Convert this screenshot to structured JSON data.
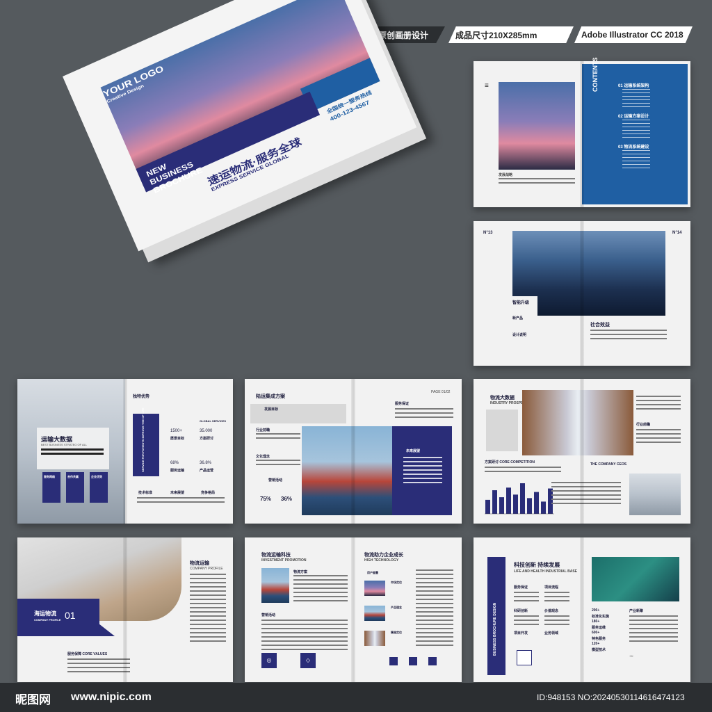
{
  "header": {
    "label1": "原创画册设计",
    "label1_icon": "Ai",
    "label2": "成品尺寸210X285mm",
    "label3": "Adobe Illustrator CC 2018"
  },
  "cover": {
    "logo": "YOUR LOGO",
    "logo_sub": "Creative Design",
    "brochure": [
      "NEW",
      "BUSINESS",
      "BROCHURE"
    ],
    "hotline_label": "全国统一服务热线",
    "hotline": "400-123-4567",
    "title_cn": "速运物流·服务全球",
    "title_en": "EXPRESS SERVICE GLOBAL"
  },
  "toc": {
    "caption": "发展战略",
    "side": "CONTENTS",
    "items": [
      {
        "num": "01",
        "label": "运输系统架构"
      },
      {
        "num": "02",
        "label": "运输方案设计"
      },
      {
        "num": "03",
        "label": "物流系统建设"
      }
    ]
  },
  "page_city": {
    "left_no": "N°13",
    "right_no": "N°14",
    "heading1": "智能升级",
    "heading2": "社合效益",
    "sub1": "新产品",
    "sub2": "设计说明"
  },
  "page_data1": {
    "left_title": "运输大数据",
    "left_sub": "BEST BUSINESS STRATEG OF ALL",
    "heading": "独特优势",
    "vertical": "SERVICE FOR PATIENTS IMPROVE THE OF LIFE",
    "stat1_num": "1500+",
    "stat1_label": "愿景目标",
    "stat2_label_en": "GLOBAL SERVICES",
    "stat2_num": "35.000",
    "stat2_label": "方案研讨",
    "stat3_num": "68%",
    "stat3_label": "服务运输",
    "stat4_num": "36.8%",
    "stat4_label": "产品运营",
    "bottom": [
      "技术标准",
      "未来展望",
      "竞争格局"
    ],
    "boxes": [
      "服务网络",
      "合作共赢",
      "企业优势"
    ]
  },
  "page_solution": {
    "title": "陆运集成方案",
    "page": "PAGE 01/02",
    "item1": "发展目标",
    "item2": "服务保证",
    "item3": "行业前瞻",
    "item4": "文化理念",
    "item5": "营销活动",
    "p1": "75%",
    "p2": "36%",
    "panel_title": "未来展望"
  },
  "page_bigdata": {
    "title": "物流大数据",
    "title_en": "INDUSTRY PROSPECTS",
    "r1": "方案研讨",
    "r1_en": "CORE COMPETITION",
    "r2": "行业前瞻",
    "r3": "THE COMPANY CEOS",
    "bars": [
      32,
      54,
      38,
      60,
      44,
      70,
      36,
      50,
      28,
      58
    ]
  },
  "page_sea": {
    "label": "海运物流",
    "label_sub": "COMPANY PROFILE",
    "num": "01",
    "right_title": "物流运输",
    "right_sub": "COMPANY PROFILE",
    "bottom": "服务保障",
    "bottom_en": "CORE VALUES"
  },
  "page_tech": {
    "left_title": "物流运输科技",
    "left_sub": "INVESTMENT PROMOTION",
    "h1": "物流方案",
    "h2": "营销活动",
    "right_title": "物流助力企业成长",
    "right_sub": "HIGH TECHNOLOGY",
    "r1": "用户留量",
    "r2": "市场定位",
    "r3": "产品理念",
    "r4": "精准定位"
  },
  "page_innov": {
    "vertical": "BUSINESS BROCHURE DESIGN",
    "title": "科技创新 持续发展",
    "sub": "LIFE AND HEALTH INDUSTRIAL BASE",
    "items": [
      "服务保证",
      "项目流程",
      "科研创新",
      "价值观念",
      "项目开发",
      "业务领域"
    ],
    "stats": [
      "200+",
      "标准化实施",
      "180+",
      "服务运维",
      "600+",
      "特色服务",
      "120+",
      "模型技术"
    ],
    "right_head": "产业新聚"
  },
  "footer": {
    "logo": "昵图网",
    "url": "www.nipic.com",
    "id": "ID:948153 NO:20240530114616474123"
  }
}
